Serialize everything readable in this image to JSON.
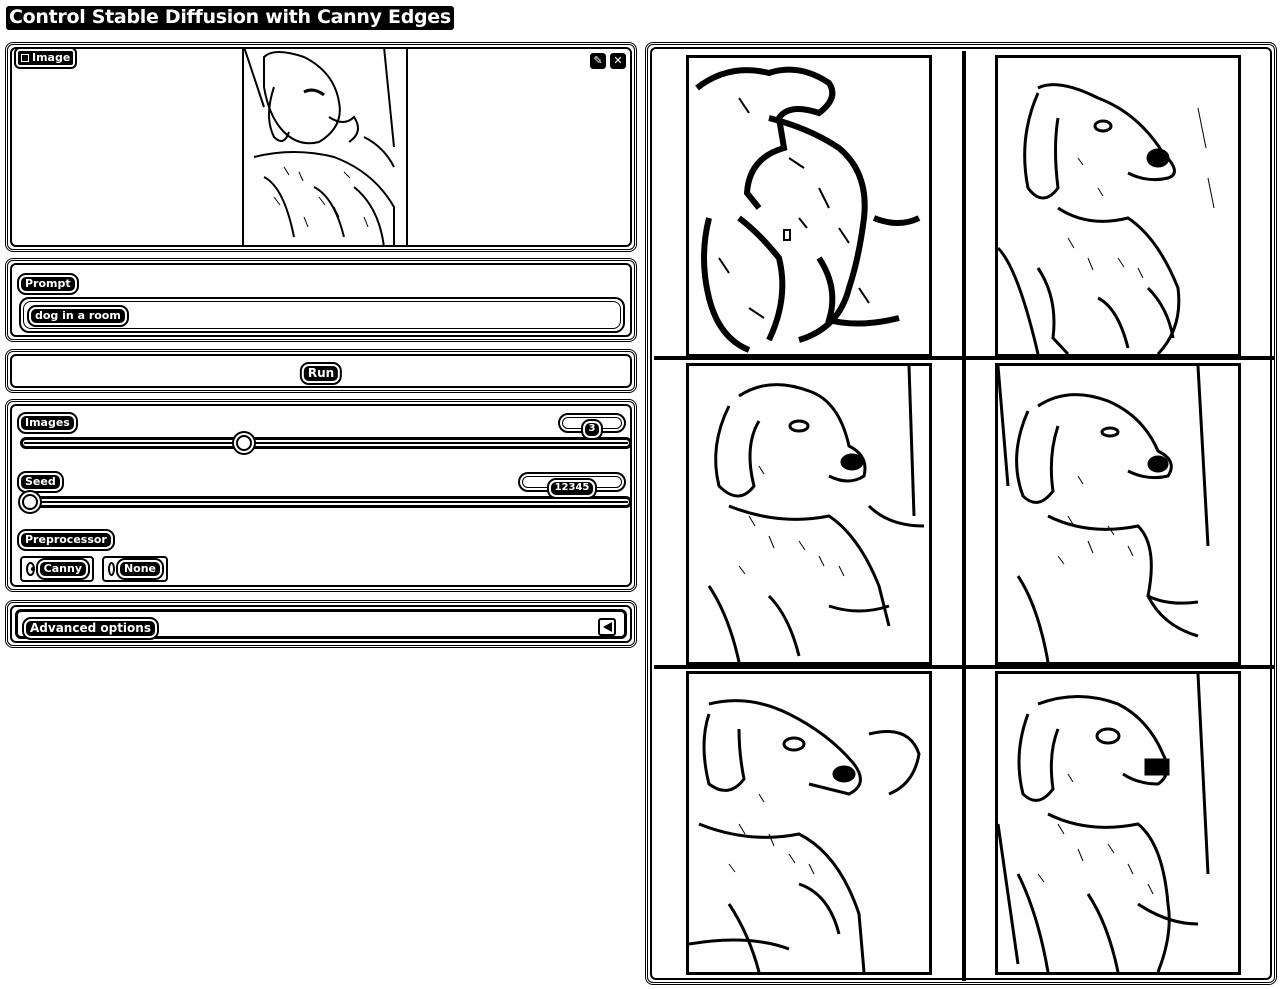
{
  "page": {
    "title": "Control Stable Diffusion with Canny Edges"
  },
  "image_input": {
    "label": "Image",
    "actions": [
      {
        "name": "edit",
        "icon": "pencil-icon"
      },
      {
        "name": "clear",
        "icon": "close-icon"
      }
    ]
  },
  "prompt": {
    "label": "Prompt",
    "value": "dog in a room"
  },
  "run": {
    "label": "Run"
  },
  "controls": {
    "images": {
      "label": "Images",
      "value": "3"
    },
    "seed": {
      "label": "Seed",
      "value": "12345"
    },
    "preprocessor": {
      "label": "Preprocessor",
      "options": [
        "Canny",
        "None"
      ],
      "selected": "Canny"
    }
  },
  "advanced": {
    "label": "Advanced options",
    "icon": "chevron-left-icon"
  },
  "gallery": {
    "count": 6
  }
}
